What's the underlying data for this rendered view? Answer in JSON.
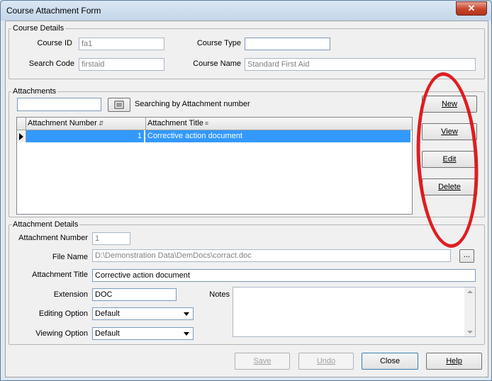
{
  "window": {
    "title": "Course Attachment Form",
    "close_glyph": "✕"
  },
  "course_details": {
    "legend": "Course Details",
    "course_id_label": "Course ID",
    "course_id_value": "fa1",
    "search_code_label": "Search Code",
    "search_code_value": "firstaid",
    "course_type_label": "Course Type",
    "course_type_value": "",
    "course_name_label": "Course Name",
    "course_name_value": "Standard First Aid"
  },
  "attachments": {
    "legend": "Attachments",
    "search_value": "",
    "search_hint": "Searching by Attachment number",
    "columns": [
      "Attachment Number",
      "Attachment Title"
    ],
    "rows": [
      {
        "number": "1",
        "title": "Corrective action document"
      }
    ],
    "buttons": {
      "new": "New",
      "view": "View",
      "edit": "Edit",
      "delete": "Delete"
    }
  },
  "attachment_details": {
    "legend": "Attachment Details",
    "number_label": "Attachment Number",
    "number_value": "1",
    "file_label": "File Name",
    "file_value": "D:\\Demonstration Data\\DemDocs\\corract.doc",
    "browse_label": "...",
    "title_label": "Attachment Title",
    "title_value": "Corrective action document",
    "extension_label": "Extension",
    "extension_value": "DOC",
    "notes_label": "Notes",
    "notes_value": "",
    "editing_label": "Editing Option",
    "editing_value": "Default",
    "viewing_label": "Viewing Option",
    "viewing_value": "Default"
  },
  "footer": {
    "save": "Save",
    "undo": "Undo",
    "close": "Close",
    "help": "Help"
  }
}
